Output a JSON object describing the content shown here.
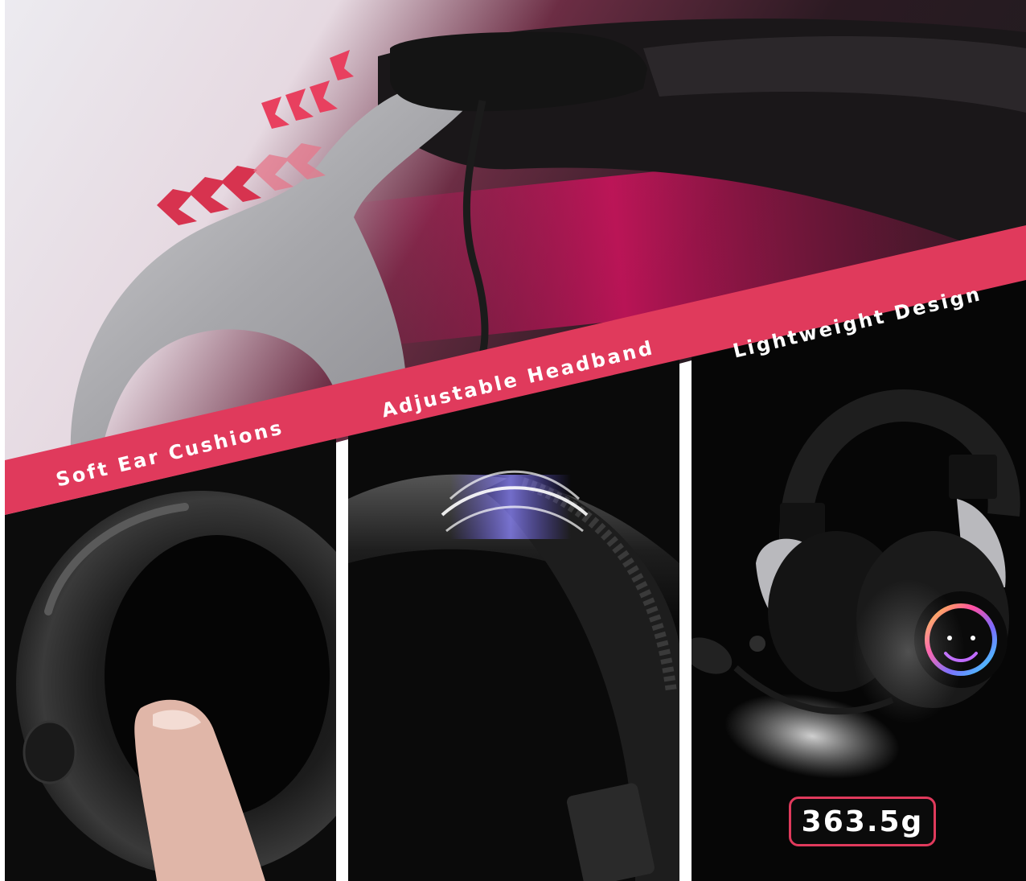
{
  "banner": {
    "color": "#e03a5c",
    "features": [
      "Soft Ear Cushions",
      "Adjustable Headband",
      "Lightweight Design"
    ]
  },
  "weight_badge": {
    "text": "363.5g",
    "border_color": "#e03a5c"
  },
  "panels": [
    {
      "subject": "ear-cushion-closeup"
    },
    {
      "subject": "braided-headband-closeup"
    },
    {
      "subject": "headset-with-microphone"
    }
  ],
  "icons": [
    "chevron-arrows-icon",
    "rgb-ring-icon",
    "feather-icon"
  ]
}
